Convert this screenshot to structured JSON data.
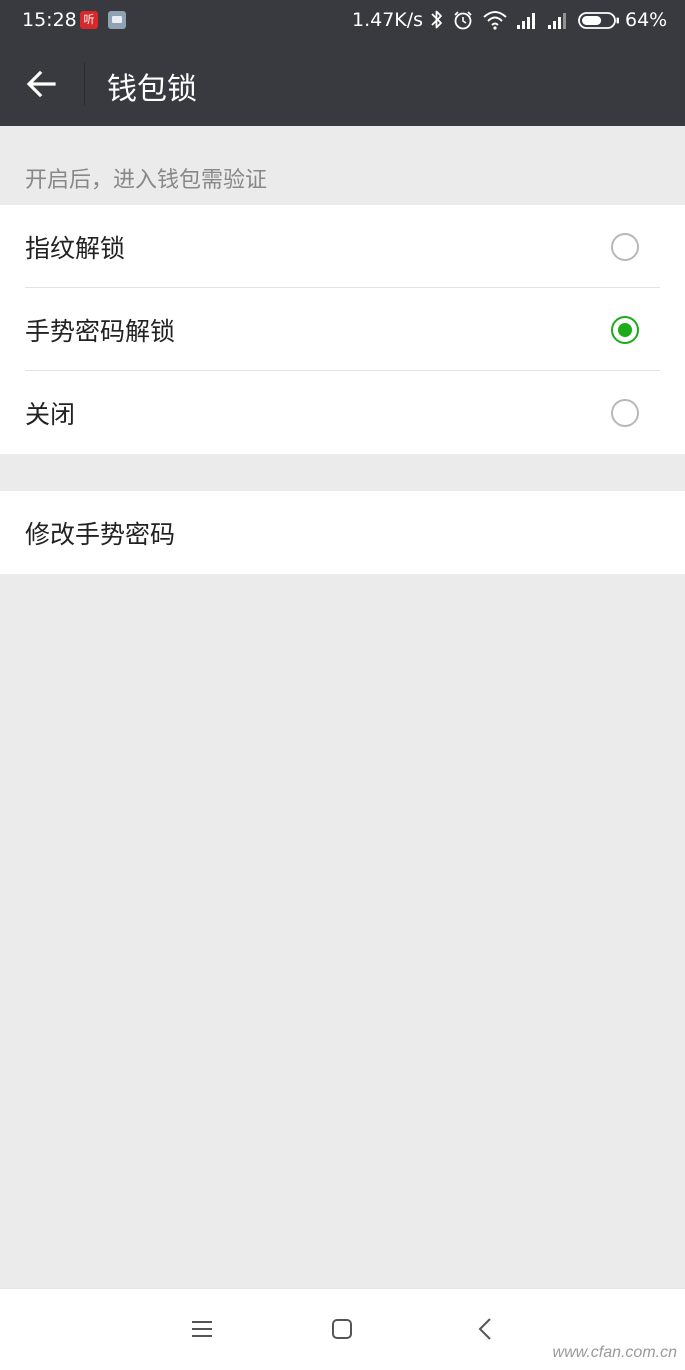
{
  "status_bar": {
    "time": "15:28",
    "notif_icon_1": "听",
    "net_speed": "1.47K/s",
    "battery": "64%",
    "battery_level": 0.64,
    "icons": [
      "bluetooth-icon",
      "alarm-icon",
      "wifi-icon",
      "signal-icon",
      "signal-icon",
      "battery-icon"
    ]
  },
  "app_bar": {
    "title": "钱包锁",
    "back_icon": "arrow-left-icon"
  },
  "settings": {
    "hint": "开启后，进入钱包需验证",
    "options": [
      {
        "label": "指纹解锁",
        "selected": false
      },
      {
        "label": "手势密码解锁",
        "selected": true
      },
      {
        "label": "关闭",
        "selected": false
      }
    ],
    "modify_label": "修改手势密码"
  },
  "nav_bar": {
    "icons": [
      "menu-icon",
      "home-icon",
      "back-icon"
    ]
  },
  "watermark": "www.cfan.com.cn",
  "colors": {
    "header": "#393a3f",
    "accent": "#1aad19",
    "background": "#ebebeb"
  }
}
